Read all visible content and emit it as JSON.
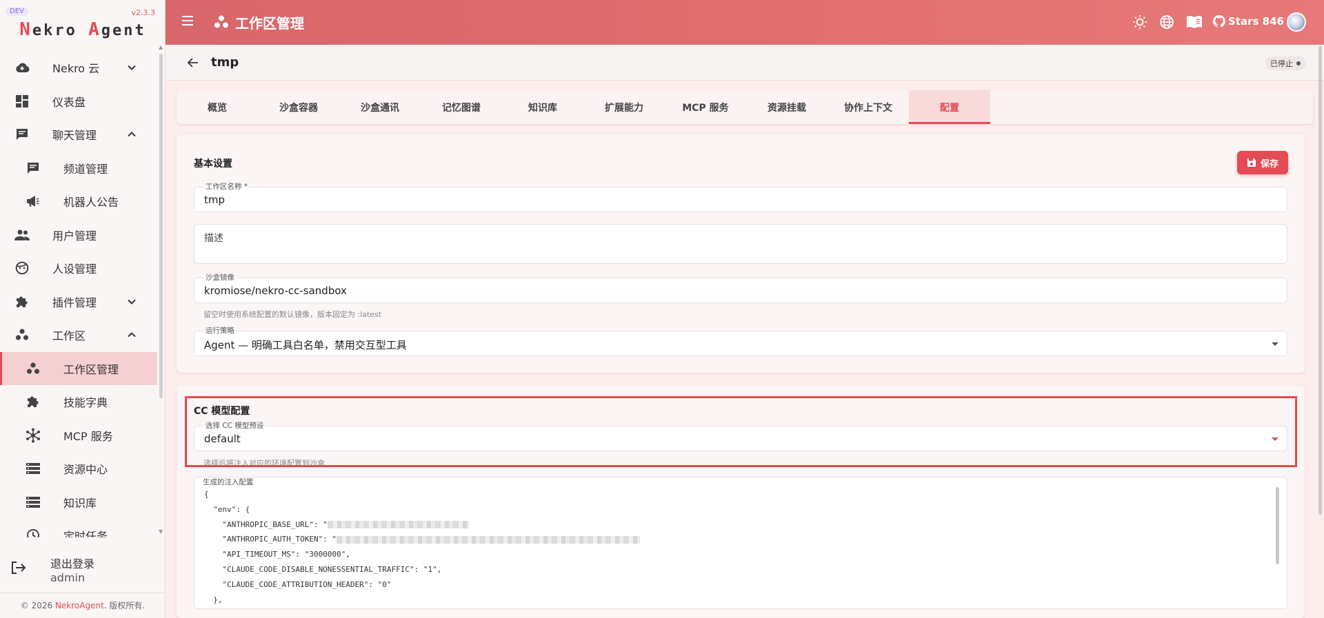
{
  "sidebar": {
    "dev_badge": "DEV",
    "version": "v2.3.3",
    "logo": {
      "first_letter": "N",
      "first_rest": "ekro ",
      "second_letter": "A",
      "second_rest": "gent"
    },
    "items": [
      {
        "label": "Nekro 云",
        "icon": "cloud-icon"
      },
      {
        "label": "仪表盘",
        "icon": "dashboard-icon"
      },
      {
        "label": "聊天管理",
        "icon": "chat-icon"
      },
      {
        "label": "频道管理",
        "icon": "message-icon"
      },
      {
        "label": "机器人公告",
        "icon": "megaphone-icon"
      },
      {
        "label": "用户管理",
        "icon": "users-icon"
      },
      {
        "label": "人设管理",
        "icon": "face-icon"
      },
      {
        "label": "插件管理",
        "icon": "puzzle-icon"
      },
      {
        "label": "工作区",
        "icon": "workspace-icon"
      },
      {
        "label": "工作区管理",
        "icon": "workspace-icon"
      },
      {
        "label": "技能字典",
        "icon": "puzzle-icon"
      },
      {
        "label": "MCP 服务",
        "icon": "hub-icon"
      },
      {
        "label": "资源中心",
        "icon": "storage-icon"
      },
      {
        "label": "知识库",
        "icon": "storage-icon"
      },
      {
        "label": "定时任务",
        "icon": "clock-icon"
      }
    ],
    "logout_label": "退出登录",
    "username": "admin",
    "copyright_prefix": "© 2026 ",
    "copyright_brand": "NekroAgent",
    "copyright_suffix": ". 版权所有."
  },
  "topbar": {
    "title": "工作区管理",
    "stars_label": "Stars 846"
  },
  "header": {
    "workspace_name": "tmp",
    "status": "已停止"
  },
  "tabs": [
    "概览",
    "沙盒容器",
    "沙盒通讯",
    "记忆图谱",
    "知识库",
    "扩展能力",
    "MCP 服务",
    "资源挂载",
    "协作上下文",
    "配置"
  ],
  "active_tab": "配置",
  "basic": {
    "title": "基本设置",
    "save_label": "保存",
    "name_label": "工作区名称 *",
    "name_value": "tmp",
    "desc_placeholder": "描述",
    "image_label": "沙盒镜像",
    "image_value": "kromiose/nekro-cc-sandbox",
    "image_hint": "留空时使用系统配置的默认镜像，版本固定为 :latest",
    "policy_label": "运行策略",
    "policy_value": "Agent — 明确工具白名单，禁用交互型工具"
  },
  "cc_model": {
    "title": "CC 模型配置",
    "preset_label": "选择 CC 模型预设",
    "preset_value": "default",
    "preset_hint": "选择后将注入对应的环境配置到沙盒",
    "generated_label": "生成的注入配置",
    "code_lines": [
      "{",
      "  \"env\": {",
      "    \"ANTHROPIC_BASE_URL\": \"",
      "    \"ANTHROPIC_AUTH_TOKEN\": \"",
      "    \"API_TIMEOUT_MS\": \"3000000\",",
      "    \"CLAUDE_CODE_DISABLE_NONESSENTIAL_TRAFFIC\": \"1\",",
      "    \"CLAUDE_CODE_ATTRIBUTION_HEADER\": \"0\"",
      "  },"
    ]
  },
  "colors": {
    "accent": "#e44b54",
    "topbar": "#e2706f",
    "highlight": "#e6484f"
  }
}
